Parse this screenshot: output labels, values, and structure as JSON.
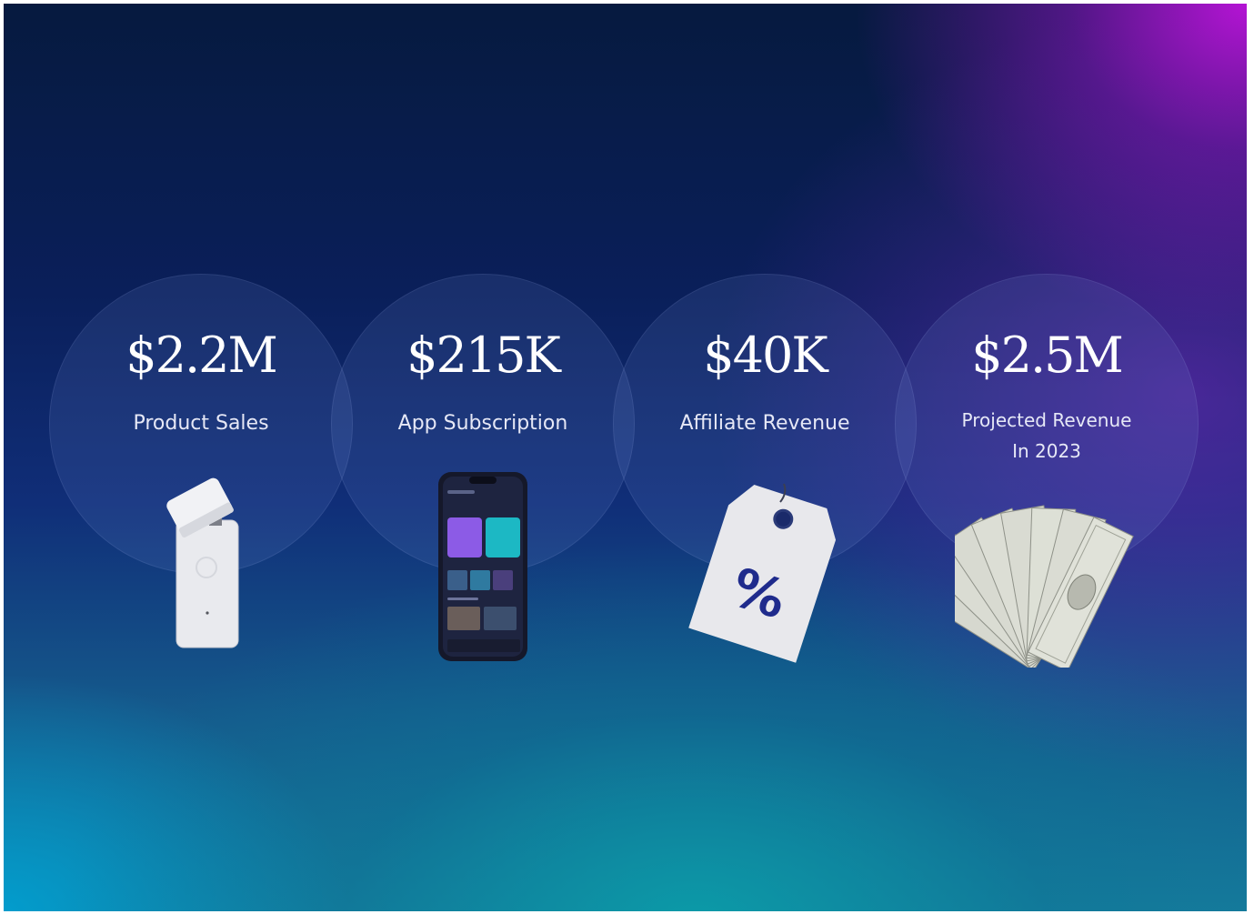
{
  "metrics": [
    {
      "amount": "$2.2M",
      "label": "Product Sales",
      "image": "white-vaporizer-device"
    },
    {
      "amount": "$215K",
      "label": "App Subscription",
      "image": "smartphone-app"
    },
    {
      "amount": "$40K",
      "label": "Affiliate Revenue",
      "image": "price-tag-percent"
    },
    {
      "amount": "$2.5M",
      "label": "Projected Revenue\nIn 2023",
      "image": "dollar-bills-fan"
    }
  ],
  "tag_symbol": "%",
  "colors": {
    "background_top": "#061a3f",
    "background_mid": "#102e78",
    "accent_magenta": "#be14dc",
    "accent_teal": "#0aa0aa",
    "text": "#ffffff"
  }
}
